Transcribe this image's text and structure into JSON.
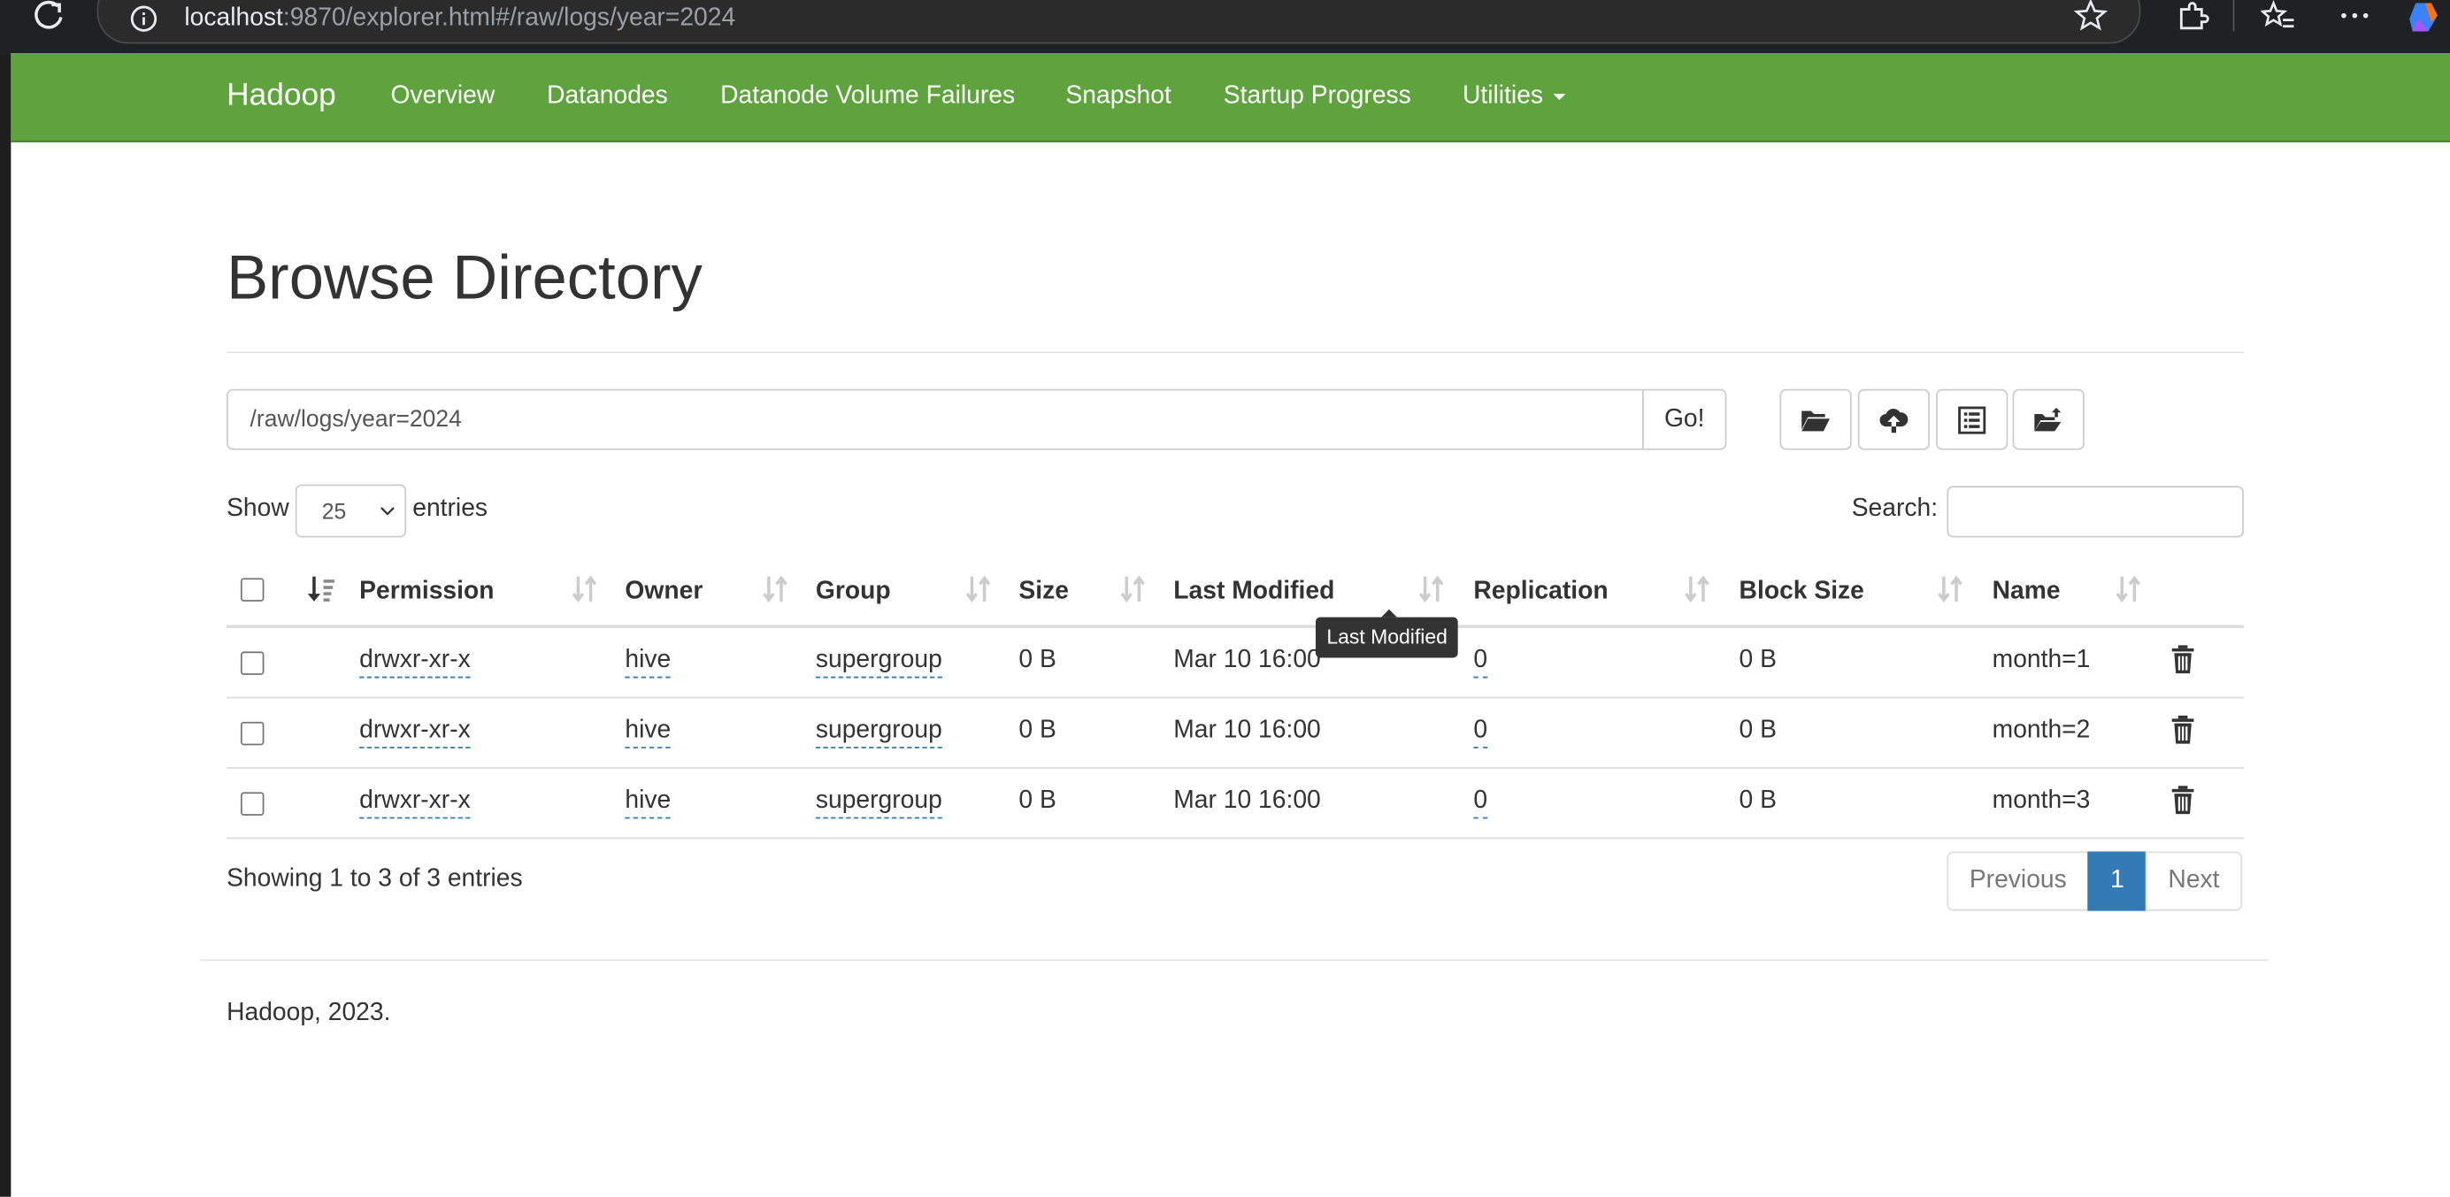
{
  "browser": {
    "url_host": "localhost",
    "url_rest": ":9870/explorer.html#/raw/logs/year=2024"
  },
  "navbar": {
    "brand": "Hadoop",
    "links": [
      "Overview",
      "Datanodes",
      "Datanode Volume Failures",
      "Snapshot",
      "Startup Progress",
      "Utilities"
    ]
  },
  "page": {
    "title": "Browse Directory",
    "path_value": "/raw/logs/year=2024",
    "go_label": "Go!",
    "show_label": "Show",
    "entries_value": "25",
    "entries_label": "entries",
    "search_label": "Search:",
    "search_value": ""
  },
  "toolbar_icons": [
    "folder-open-icon",
    "cloud-upload-icon",
    "list-alt-icon",
    "folder-paste-icon"
  ],
  "table": {
    "columns": [
      "Permission",
      "Owner",
      "Group",
      "Size",
      "Last Modified",
      "Replication",
      "Block Size",
      "Name"
    ],
    "rows": [
      {
        "permission": "drwxr-xr-x",
        "owner": "hive",
        "group": "supergroup",
        "size": "0 B",
        "modified": "Mar 10 16:00",
        "replication": "0",
        "block_size": "0 B",
        "name": "month=1"
      },
      {
        "permission": "drwxr-xr-x",
        "owner": "hive",
        "group": "supergroup",
        "size": "0 B",
        "modified": "Mar 10 16:00",
        "replication": "0",
        "block_size": "0 B",
        "name": "month=2"
      },
      {
        "permission": "drwxr-xr-x",
        "owner": "hive",
        "group": "supergroup",
        "size": "0 B",
        "modified": "Mar 10 16:00",
        "replication": "0",
        "block_size": "0 B",
        "name": "month=3"
      }
    ]
  },
  "tooltip": "Last Modified",
  "info": "Showing 1 to 3 of 3 entries",
  "pagination": {
    "previous": "Previous",
    "current": "1",
    "next": "Next"
  },
  "footer": "Hadoop, 2023.",
  "colors": {
    "navbar": "#5fa33e",
    "link": "#337ab7",
    "active_page": "#337ab7"
  }
}
